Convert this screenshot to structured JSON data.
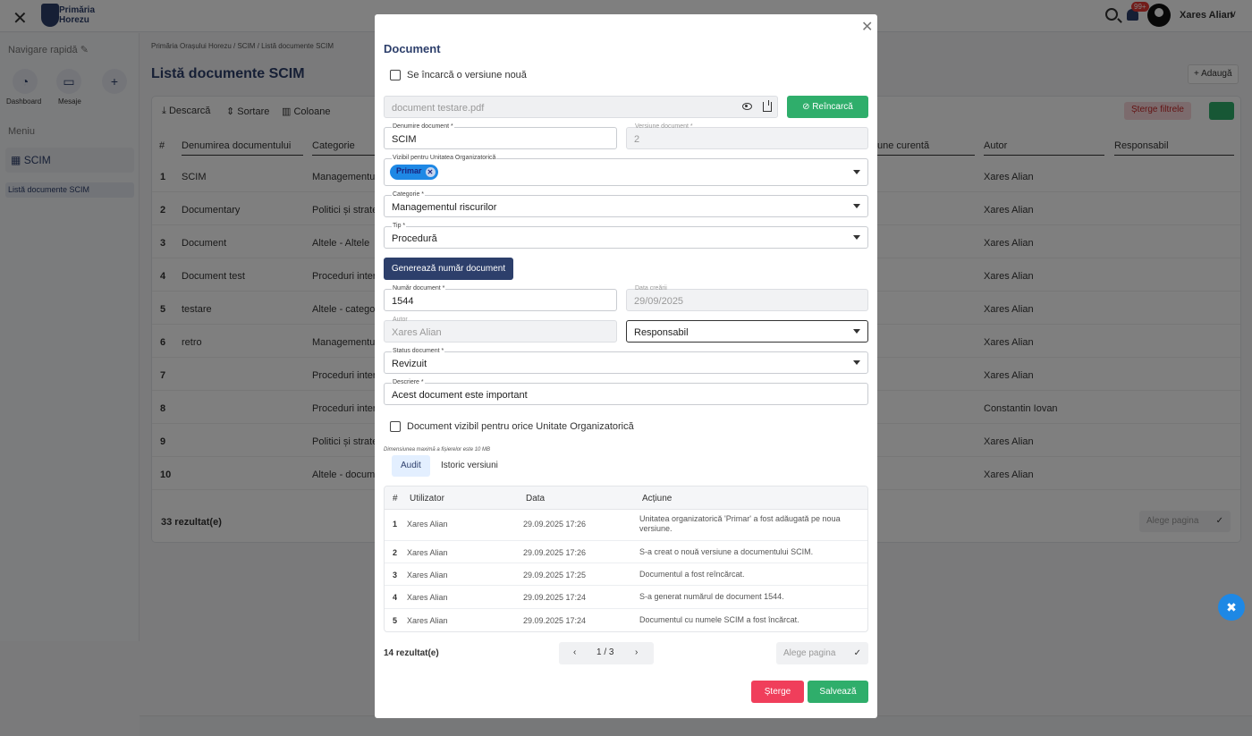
{
  "topbar": {
    "close_icon": "close-icon",
    "logo_text": "Primăria Horezu",
    "notification_count": "99+",
    "user_name": "Xares Alian"
  },
  "sidebar": {
    "quick_nav_title": "Navigare rapidă",
    "quick_actions": [
      {
        "label": "Dashboard",
        "icon": "pie-chart-icon"
      },
      {
        "label": "Mesaje",
        "icon": "inbox-icon"
      },
      {
        "label": "",
        "icon": "plus-icon"
      }
    ],
    "menu_title": "Meniu",
    "menu_item": "SCIM",
    "submenu_item": "Listă documente SCIM"
  },
  "main": {
    "breadcrumb": "Primăria Orașului Horezu  /  SCIM  /  Listă documente SCIM",
    "title": "Listă documente SCIM",
    "add_label": "+ Adaugă",
    "toolbar": {
      "download": "Descarcă",
      "sort": "Sortare",
      "columns": "Coloane",
      "clear_filters": "Șterge filtrele"
    },
    "columns": [
      "#",
      "Denumirea documentului",
      "Categorie",
      "une curentă",
      "Autor",
      "Responsabil"
    ],
    "rows": [
      {
        "num": "1",
        "name": "SCIM",
        "category": "Managementul",
        "author": "Xares Alian"
      },
      {
        "num": "2",
        "name": "Documentary",
        "category": "Politici și strateg",
        "author": "Xares Alian"
      },
      {
        "num": "3",
        "name": "Document",
        "category": "Altele - Altele",
        "author": "Xares Alian"
      },
      {
        "num": "4",
        "name": "Document test",
        "category": "Proceduri intern",
        "author": "Xares Alian"
      },
      {
        "num": "5",
        "name": "testare",
        "category": "Altele - categori",
        "author": "Xares Alian"
      },
      {
        "num": "6",
        "name": "retro",
        "category": "Managementul",
        "author": "Xares Alian"
      },
      {
        "num": "7",
        "name": "",
        "category": "Proceduri intern",
        "author": "Xares Alian"
      },
      {
        "num": "8",
        "name": "",
        "category": "Proceduri intern",
        "author": "Constantin Iovan"
      },
      {
        "num": "9",
        "name": "",
        "category": "Politici și strateg",
        "author": "Xares Alian"
      },
      {
        "num": "10",
        "name": "",
        "category": "Altele - docume",
        "author": "Xares Alian"
      }
    ],
    "results": "33 rezultat(e)",
    "page_select": "Alege pagina"
  },
  "modal": {
    "title": "Document",
    "new_version_label": "Se încarcă o versiune nouă",
    "file_name": "document testare.pdf",
    "reload_label": "Reîncarcă",
    "name_label": "Denumire document *",
    "name_value": "SCIM",
    "version_label": "Versiune document *",
    "version_value": "2",
    "visible_label": "Vizibil pentru Unitatea Organizatorică",
    "visible_chip": "Primar",
    "category_label": "Categorie *",
    "category_value": "Managementul riscurilor",
    "type_label": "Tip *",
    "type_value": "Procedură",
    "generate_label": "Generează număr document",
    "number_label": "Număr document *",
    "number_value": "1544",
    "created_label": "Data creării",
    "created_value": "29/09/2025",
    "author_label": "Autor",
    "author_value": "Xares Alian",
    "responsible_value": "Responsabil",
    "status_label": "Status document *",
    "status_value": "Revizuit",
    "description_label": "Descriere *",
    "description_value": "Acest document este important",
    "visible_all_label": "Document vizibil pentru orice Unitate Organizatorică",
    "size_note": "Dimensiunea maximă a fișierelor este 10 MB",
    "tabs": [
      "Audit",
      "Istoric versiuni"
    ],
    "audit_columns": [
      "#",
      "Utilizator",
      "Data",
      "Acțiune"
    ],
    "audit_rows": [
      {
        "num": "1",
        "user": "Xares Alian",
        "date": "29.09.2025 17:26",
        "action": "Unitatea organizatorică 'Primar' a fost adăugată pe noua versiune."
      },
      {
        "num": "2",
        "user": "Xares Alian",
        "date": "29.09.2025 17:26",
        "action": "S-a creat o nouă versiune a documentului SCIM."
      },
      {
        "num": "3",
        "user": "Xares Alian",
        "date": "29.09.2025 17:25",
        "action": "Documentul a fost reîncărcat."
      },
      {
        "num": "4",
        "user": "Xares Alian",
        "date": "29.09.2025 17:24",
        "action": "S-a generat numărul de document 1544."
      },
      {
        "num": "5",
        "user": "Xares Alian",
        "date": "29.09.2025 17:24",
        "action": "Documentul cu numele SCIM a fost încărcat."
      }
    ],
    "results": "14 rezultat(e)",
    "page_indicator": "1 / 3",
    "page_select": "Alege pagina",
    "delete_label": "Șterge",
    "save_label": "Salvează"
  }
}
